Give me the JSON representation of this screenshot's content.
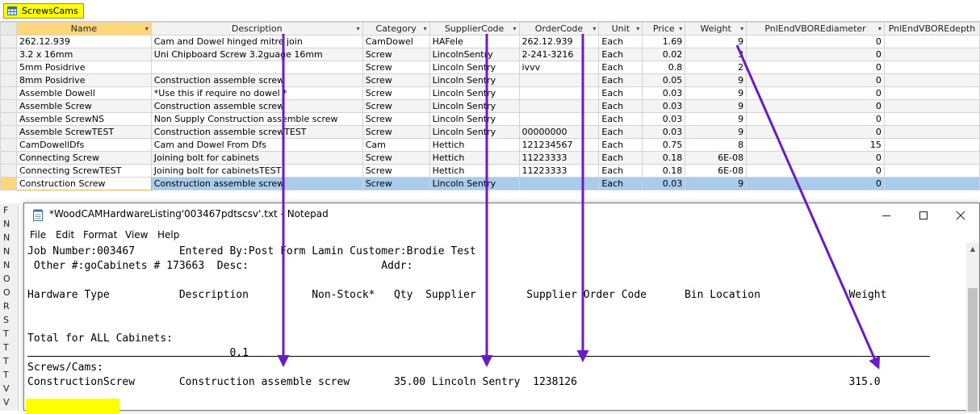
{
  "datasheet": {
    "tab_label": "ScrewsCams",
    "columns": [
      "Name",
      "Description",
      "Category",
      "SupplierCode",
      "OrderCode",
      "Unit",
      "Price",
      "Weight",
      "PnlEndVBOREdiameter",
      "PnlEndVBOREdepth"
    ],
    "rows": [
      [
        "262.12.939",
        "Cam and Dowel hinged mitre join",
        "CamDowel",
        "HAFele",
        "262.12.939",
        "Each",
        "1.69",
        "9",
        "0",
        ""
      ],
      [
        "3.2 x 16mm",
        "Uni Chipboard Screw 3.2guage 16mm",
        "Screw",
        "LincolnSentry",
        "2-241-3216",
        "Each",
        "0.02",
        "3",
        "0",
        ""
      ],
      [
        "5mm Posidrive",
        "",
        "Screw",
        "Lincoln Sentry",
        "ivvv",
        "Each",
        "0.8",
        "2",
        "0",
        ""
      ],
      [
        "8mm Posidrive",
        "Construction assemble screw",
        "Screw",
        "Lincoln Sentry",
        "",
        "Each",
        "0.05",
        "9",
        "0",
        ""
      ],
      [
        "Assemble Dowell",
        "*Use this if require no dowel *",
        "Screw",
        "Lincoln Sentry",
        "",
        "Each",
        "0.03",
        "9",
        "0",
        ""
      ],
      [
        "Assemble Screw",
        "Construction assemble screw",
        "Screw",
        "Lincoln Sentry",
        "",
        "Each",
        "0.03",
        "9",
        "0",
        ""
      ],
      [
        "Assemble ScrewNS",
        "Non Supply Construction assemble screw",
        "Screw",
        "Lincoln Sentry",
        "",
        "Each",
        "0.03",
        "9",
        "0",
        ""
      ],
      [
        "Assemble ScrewTEST",
        "Construction assemble screwTEST",
        "Screw",
        "Lincoln Sentry",
        "00000000",
        "Each",
        "0.03",
        "9",
        "0",
        ""
      ],
      [
        "CamDowellDfs",
        "Cam and Dowel From Dfs",
        "Cam",
        "Hettich",
        "121234567",
        "Each",
        "0.75",
        "8",
        "15",
        ""
      ],
      [
        "Connecting Screw",
        "Joining bolt for cabinets",
        "Screw",
        "Hettich",
        "11223333",
        "Each",
        "0.18",
        "6E-08",
        "0",
        ""
      ],
      [
        "Connecting ScrewTEST",
        "Joining bolt for cabinetsTEST",
        "Screw",
        "Hettich",
        "11223333",
        "Each",
        "0.18",
        "6E-08",
        "0",
        ""
      ],
      [
        "Construction Screw",
        "Construction assemble screw",
        "Screw",
        "Lincoln Sentry",
        "",
        "Each",
        "0.03",
        "9",
        "0",
        ""
      ]
    ],
    "current_row_index": 11,
    "row_stub_letters": [
      "F",
      "N",
      "N",
      "N",
      "N",
      "O",
      "O",
      "R",
      "S",
      "T",
      "T",
      "T",
      "T",
      "V",
      "V"
    ]
  },
  "notepad": {
    "title": "*WoodCAMHardwareListing'003467pdtscsv'.txt - Notepad",
    "menu": [
      "File",
      "Edit",
      "Format",
      "View",
      "Help"
    ],
    "lines": [
      "Job Number:003467       Entered By:Post Form Lamin Customer:Brodie Test",
      " Other #:goCabinets # 173663  Desc:                     Addr:",
      "",
      "Hardware Type           Description          Non-Stock*   Qty  Supplier        Supplier Order Code      Bin Location              Weight",
      "",
      "",
      "Total for ALL Cabinets:",
      "                                0.1",
      "Screws/Cams:",
      "ConstructionScrew       Construction assemble screw       35.00 Lincoln Sentry  1238126                                           315.0"
    ]
  },
  "colors": {
    "highlight": "#ffff00",
    "arrow": "#6a1cc4",
    "selected_row": "#a9cbec",
    "name_header": "#ffd77a"
  }
}
